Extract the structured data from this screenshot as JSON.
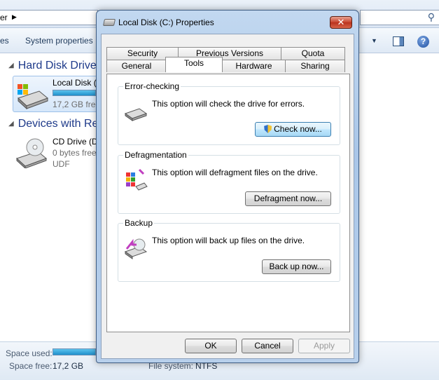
{
  "explorer": {
    "address_text": "er",
    "cmd_cut": "es",
    "cmd_system_properties": "System properties",
    "group_hard_disks": "Hard Disk Drives",
    "group_removable": "Devices with Rem",
    "local_disk_name": "Local Disk (C",
    "local_disk_free": "17,2 GB free",
    "cd_drive_name": "CD Drive (D",
    "cd_drive_free": "0 bytes free",
    "cd_drive_fs": "UDF",
    "status_space_used_label": "Space used:",
    "status_space_free_label": "Space free:",
    "status_space_free_value": "17,2 GB",
    "status_fs_label": "File system:",
    "status_fs_value": "NTFS"
  },
  "dialog": {
    "title": "Local Disk (C:) Properties",
    "close_glyph": "✕",
    "tabs_row1": [
      "Security",
      "Previous Versions",
      "Quota"
    ],
    "tabs_row2": [
      "General",
      "Tools",
      "Hardware",
      "Sharing"
    ],
    "active_tab": "Tools",
    "sections": [
      {
        "title": "Error-checking",
        "text": "This option will check the drive for errors.",
        "button": "Check now..."
      },
      {
        "title": "Defragmentation",
        "text": "This option will defragment files on the drive.",
        "button": "Defragment now..."
      },
      {
        "title": "Backup",
        "text": "This option will back up files on the drive.",
        "button": "Back up now..."
      }
    ],
    "ok": "OK",
    "cancel": "Cancel",
    "apply": "Apply"
  }
}
